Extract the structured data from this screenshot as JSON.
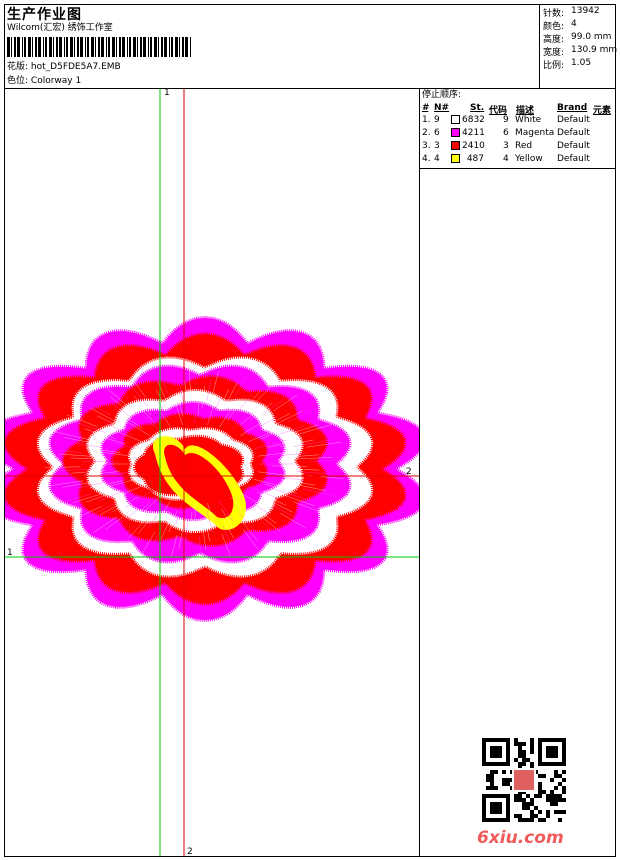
{
  "header": {
    "title": "生产作业图",
    "studio": "Wilcom(汇宏) 绣饰工作室",
    "design_label": "花版:",
    "design_value": "hot_D5FDE5A7.EMB",
    "colorway_label": "色位:",
    "colorway_value": "Colorway 1"
  },
  "stats": {
    "stitches_label": "针数:",
    "stitches": "13942",
    "colors_label": "颜色:",
    "colors": "4",
    "height_label": "高度:",
    "height": "99.0 mm",
    "width_label": "宽度:",
    "width": "130.9 mm",
    "ratio_label": "比例:",
    "ratio": "1.05"
  },
  "sequence": {
    "title": "停止顺序:",
    "headers": {
      "num": "#",
      "n": "N#",
      "st": "St.",
      "code": "代码",
      "desc": "描述",
      "brand": "Brand",
      "element": "元素"
    },
    "rows": [
      {
        "num": "1.",
        "n": "9",
        "color": "#ffffff",
        "st": "6832",
        "code": "9",
        "desc": "White",
        "brand": "Default"
      },
      {
        "num": "2.",
        "n": "6",
        "color": "#ff00ff",
        "st": "4211",
        "code": "6",
        "desc": "Magenta",
        "brand": "Default"
      },
      {
        "num": "3.",
        "n": "3",
        "color": "#ff0000",
        "st": "2410",
        "code": "3",
        "desc": "Red",
        "brand": "Default"
      },
      {
        "num": "4.",
        "n": "4",
        "color": "#ffff00",
        "st": "487",
        "code": "4",
        "desc": "Yellow",
        "brand": "Default"
      }
    ]
  },
  "axes": {
    "green_top": "1",
    "green_left": "1",
    "red_right": "2",
    "red_bottom": "2"
  },
  "colors": {
    "green_axis": "#00c800",
    "red_axis": "#e00000",
    "white": "#ffffff",
    "magenta": "#ff00ff",
    "red": "#ff0000",
    "yellow": "#ffff00"
  },
  "watermark": "6xiu.com"
}
